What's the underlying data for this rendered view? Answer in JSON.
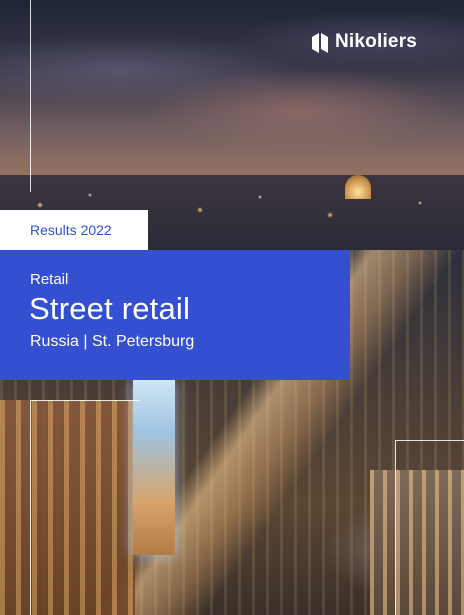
{
  "brand": {
    "name": "Nikoliers",
    "logo_icon": "nikoliers-n-mark-icon",
    "text_color": "#ffffff"
  },
  "cover": {
    "badge": "Results 2022",
    "category": "Retail",
    "title": "Street retail",
    "subtitle": "Russia | St. Petersburg",
    "accent_color": "#3450d1",
    "badge_text_color": "#2f4fd0"
  }
}
